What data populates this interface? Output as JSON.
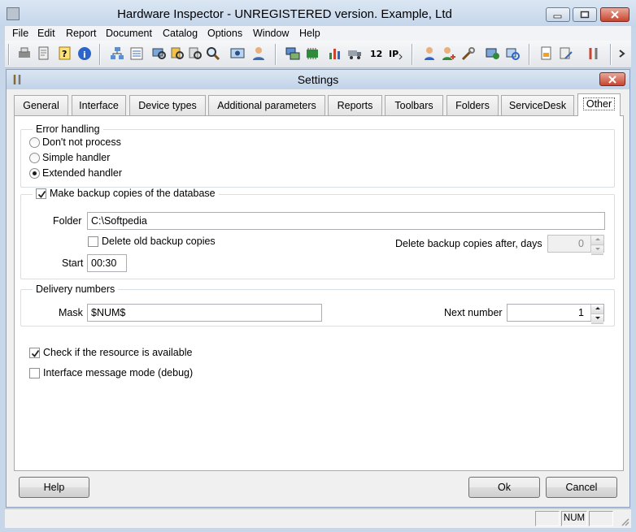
{
  "window": {
    "title": "Hardware Inspector - UNREGISTERED version. Example, Ltd"
  },
  "menu": [
    "File",
    "Edit",
    "Report",
    "Document",
    "Catalog",
    "Options",
    "Window",
    "Help"
  ],
  "dialog": {
    "title": "Settings",
    "tabs": [
      "General",
      "Interface",
      "Device types",
      "Additional parameters",
      "Reports",
      "Toolbars",
      "Folders",
      "ServiceDesk",
      "Other"
    ],
    "active_tab": "Other",
    "error_handling": {
      "legend": "Error handling",
      "options": [
        "Don't not process",
        "Simple handler",
        "Extended handler"
      ],
      "selected": "Extended handler"
    },
    "backup": {
      "checkbox_label": "Make backup copies of the database",
      "checked": true,
      "folder_label": "Folder",
      "folder_value": "C:\\Softpedia",
      "delete_old_label": "Delete old backup copies",
      "delete_old_checked": false,
      "delete_after_label": "Delete backup copies after, days",
      "delete_after_value": "0",
      "start_label": "Start",
      "start_value": "00:30"
    },
    "delivery": {
      "legend": "Delivery numbers",
      "mask_label": "Mask",
      "mask_value": "$NUM$",
      "next_label": "Next number",
      "next_value": "1"
    },
    "check_resource": {
      "label": "Check if the resource is available",
      "checked": true
    },
    "debug_mode": {
      "label": "Interface message mode (debug)",
      "checked": false
    },
    "buttons": {
      "help": "Help",
      "ok": "Ok",
      "cancel": "Cancel"
    }
  },
  "statusbar": {
    "num": "NUM"
  },
  "colors": {
    "title_bar": "#c7d6e8",
    "close_red": "#c8452f",
    "dialog_bg": "#f0f0f0"
  }
}
